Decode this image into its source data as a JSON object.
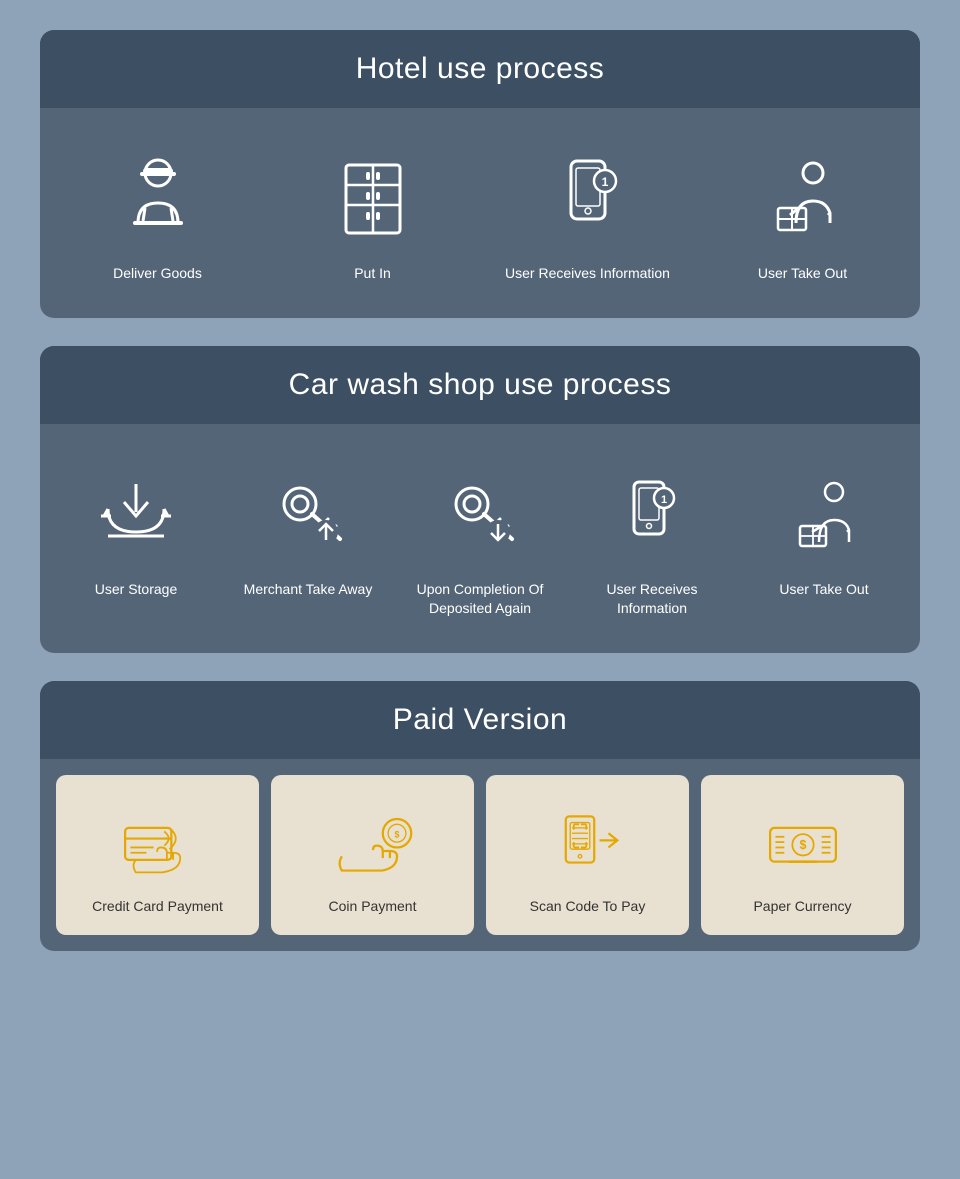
{
  "hotel_section": {
    "title": "Hotel use process",
    "items": [
      {
        "label": "Deliver Goods",
        "icon": "deliver-goods"
      },
      {
        "label": "Put In",
        "icon": "put-in"
      },
      {
        "label": "User Receives Information",
        "icon": "user-receives"
      },
      {
        "label": "User Take Out",
        "icon": "user-take-out"
      }
    ]
  },
  "carwash_section": {
    "title": "Car wash shop use process",
    "items": [
      {
        "label": "User Storage",
        "icon": "user-storage"
      },
      {
        "label": "Merchant Take Away",
        "icon": "merchant-take-away"
      },
      {
        "label": "Upon Completion Of Deposited Again",
        "icon": "deposited-again"
      },
      {
        "label": "User Receives Information",
        "icon": "user-receives-2"
      },
      {
        "label": "User Take Out",
        "icon": "user-take-out-2"
      }
    ]
  },
  "paid_section": {
    "title": "Paid Version",
    "items": [
      {
        "label": "Credit Card Payment",
        "icon": "credit-card"
      },
      {
        "label": "Coin Payment",
        "icon": "coin-payment"
      },
      {
        "label": "Scan Code To Pay",
        "icon": "scan-code"
      },
      {
        "label": "Paper Currency",
        "icon": "paper-currency"
      }
    ]
  }
}
